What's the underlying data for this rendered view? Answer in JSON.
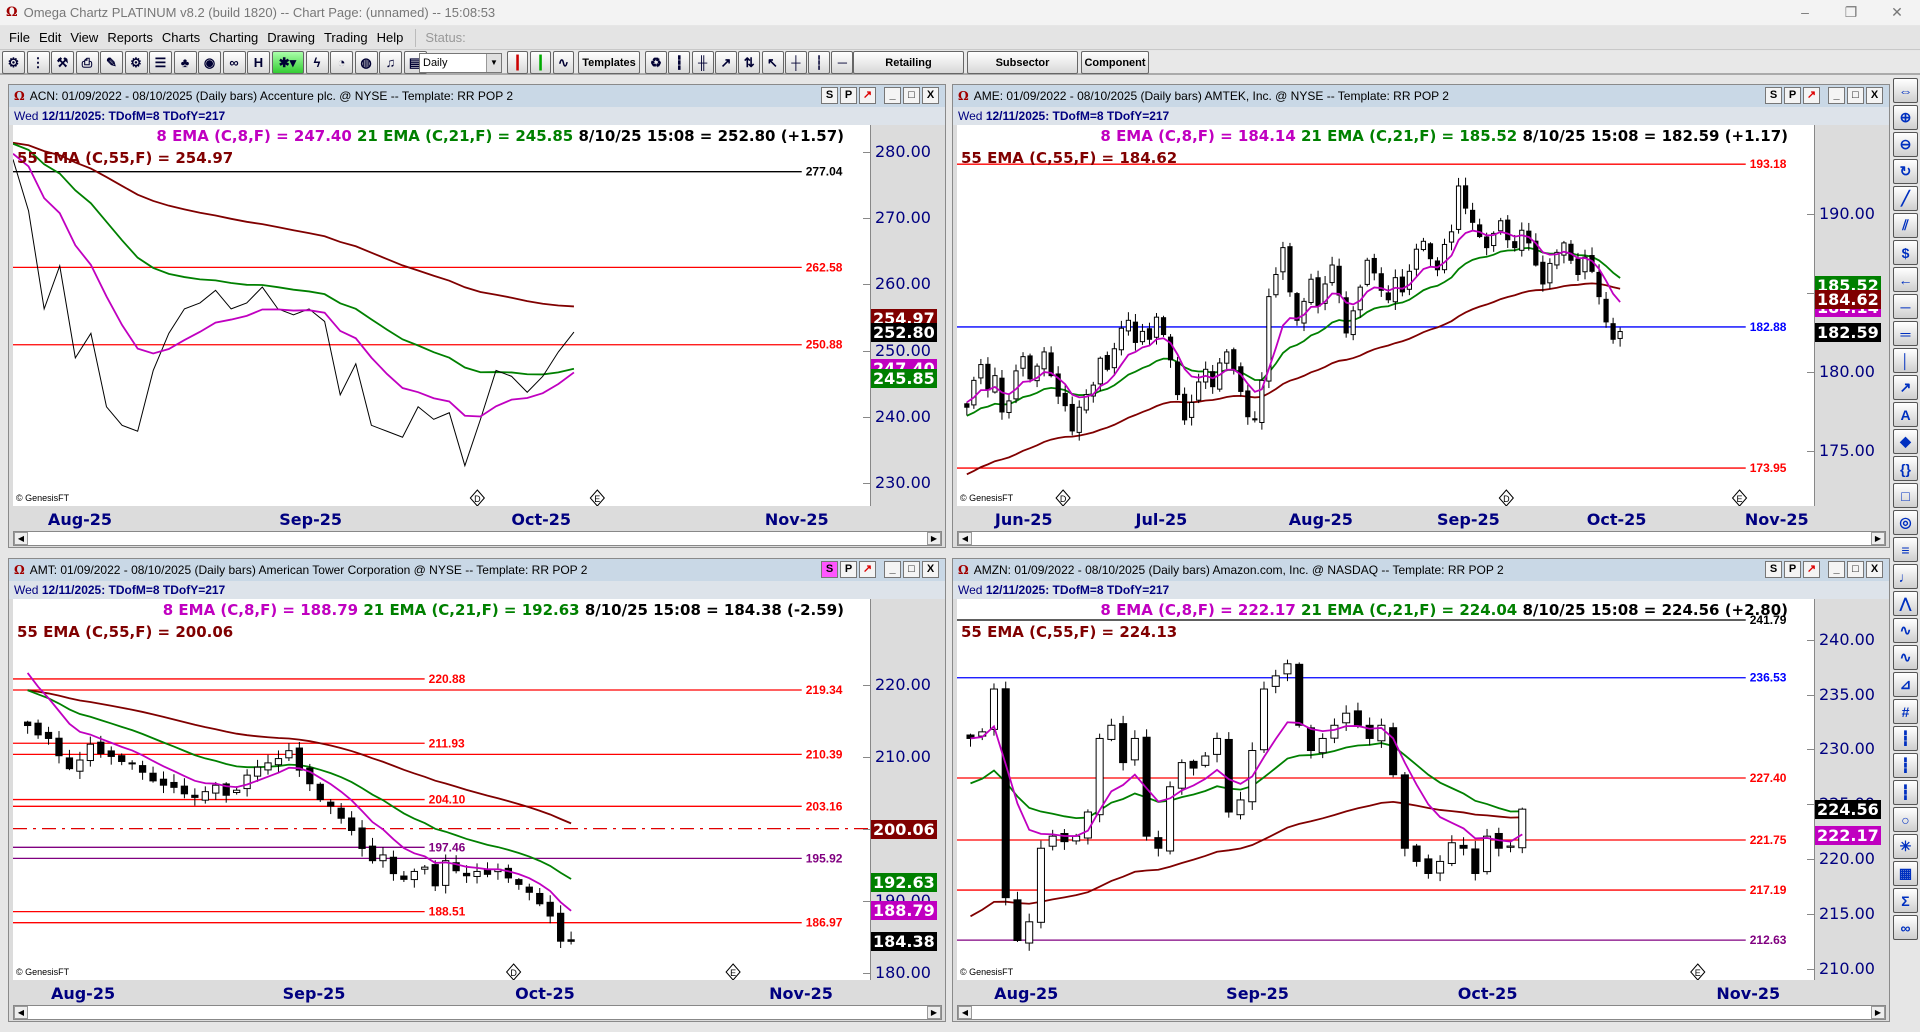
{
  "window": {
    "title": "Omega Chartz PLATINUM v8.2 (build 1820)  --  Chart Page: (unnamed) -- 15:08:53",
    "minimize": "–",
    "restore": "❐",
    "close": "✕"
  },
  "menu": [
    "File",
    "Edit",
    "View",
    "Reports",
    "Charts",
    "Charting",
    "Drawing",
    "Trading",
    "Help"
  ],
  "status_label": "Status:",
  "toolbar": {
    "icons_left": [
      "gear-icon",
      "traffic-light-icon",
      "tools-icon",
      "printer-icon",
      "pen-icon",
      "gears-icon",
      "list-icon",
      "hierarchy-icon",
      "camera-icon",
      "link-icon",
      "ladder-icon"
    ],
    "icons_mid": [
      "lightning-icon",
      "gauge-icon",
      "disk-icon",
      "bell-icon",
      "notes-icon"
    ],
    "period": "Daily",
    "templates": "Templates",
    "retailing": "Retailing",
    "subsector": "Subsector",
    "component": "Component",
    "icons_right": [
      "recycle-icon",
      "bars-icon",
      "bars-red-icon",
      "trend-icon",
      "sort-icon",
      "cursor-icon",
      "crosshair-icon",
      "vline-icon",
      "hline-icon"
    ]
  },
  "right_toolbar": [
    "pan-icon",
    "zoom-in-icon",
    "zoom-out-icon",
    "refresh-icon",
    "trendline-icon",
    "channel-icon",
    "dollar-line-icon",
    "arrow-left-icon",
    "horizontal-line-icon",
    "double-line-icon",
    "vertical-line-icon",
    "arrow-icon",
    "text-icon",
    "shapes-icon",
    "brackets-icon",
    "rectangle-icon",
    "circle-icon",
    "rps-icon",
    "fib-icon",
    "pattern-icon",
    "wave-icon",
    "wave2-icon",
    "fan-icon",
    "grid-icon",
    "bars2-icon",
    "bars3-icon",
    "bars4-icon",
    "cycles-icon",
    "gann-icon",
    "boxes-icon",
    "sigma-icon",
    "chain-icon"
  ],
  "colors": {
    "ema8": "#c000c0",
    "ema21": "#008000",
    "ema55": "#800000",
    "close": "#000000",
    "up": "#ffffff",
    "down": "#000000"
  },
  "panels": [
    {
      "symbol": "ACN",
      "title": "ACN:  01/09/2022 - 08/10/2025  (Daily bars)  Accenture plc. @ NYSE  --  Template: RR POP 2",
      "day": "Wed",
      "date_info": "12/11/2025:  TDofM=8  TDofY=217",
      "ema8_label": "8 EMA (C,8,F) = 247.40",
      "ema21_label": "21 EMA (C,21,F) = 245.85",
      "last_label": "8/10/25 15:08 = 252.80 (+1.57)",
      "ema55_label": "55 EMA (C,55,F) = 254.97",
      "style": "line",
      "y_range": [
        226.5,
        284.1
      ],
      "slots": 55,
      "start": 0,
      "closes": [
        278.9,
        271.1,
        256.3,
        262.8,
        248.9,
        252.6,
        241.5,
        238.7,
        237.8,
        247,
        252.6,
        256.3,
        257.2,
        259.1,
        256.3,
        257.2,
        259.6,
        256.3,
        255.4,
        256.3,
        254.4,
        243.3,
        248,
        238.7,
        237.8,
        236.9,
        241.5,
        239.6,
        240.6,
        232.6,
        239.6,
        247,
        246.1,
        243.7,
        246.1,
        249.8,
        252.8
      ],
      "ema_seed": [
        280,
        281.5,
        281.5
      ],
      "y_ticks": [
        280,
        270,
        260,
        250,
        240,
        230
      ],
      "levels": [
        {
          "value": 277.04,
          "label": "277.04",
          "color": "#000000",
          "pos": "right"
        },
        {
          "value": 262.58,
          "label": "262.58",
          "color": "#ff0000",
          "pos": "right"
        },
        {
          "value": 250.88,
          "label": "250.88",
          "color": "#ff0000",
          "pos": "right"
        }
      ],
      "value_boxes": [
        {
          "text": "254.97",
          "color": "#800000"
        },
        {
          "text": "252.80",
          "color": "#000000"
        },
        {
          "text": "247.40",
          "color": "#c000c0"
        },
        {
          "text": "245.85",
          "color": "#008000"
        }
      ],
      "months": [
        {
          "label": "Aug-25",
          "i": 4.3
        },
        {
          "label": "Sep-25",
          "i": 19.1
        },
        {
          "label": "Oct-25",
          "i": 33.9
        },
        {
          "label": "Nov-25",
          "i": 50.3
        }
      ],
      "events": [
        {
          "label": "D",
          "i": 29.8
        },
        {
          "label": "E",
          "i": 37.5
        }
      ],
      "credit": "© GenesisFT",
      "s_active": false
    },
    {
      "symbol": "AME",
      "title": "AME:  01/09/2022 - 08/10/2025  (Daily bars)  AMTEK, Inc. @ NYSE  --  Template: RR POP 2",
      "day": "Wed",
      "date_info": "12/11/2025:  TDofM=8  TDofY=217",
      "ema8_label": "8 EMA (C,8,F) = 184.14",
      "ema21_label": "21 EMA (C,21,F) = 185.52",
      "last_label": "8/10/25 15:08 = 182.59 (+1.17)",
      "ema55_label": "55 EMA (C,55,F) = 184.62",
      "style": "candle",
      "y_range": [
        171.55,
        195.66
      ],
      "slots": 122,
      "start": 1.4,
      "closes": [
        177.8,
        179.5,
        180.5,
        178.9,
        179.8,
        177.5,
        178.2,
        180.1,
        181,
        179.6,
        180.4,
        181.3,
        179.8,
        178.5,
        177.9,
        176.3,
        177.8,
        178.6,
        179.2,
        180.9,
        180.2,
        181.5,
        182.8,
        183.3,
        181.9,
        182.6,
        182.1,
        183.5,
        182.4,
        180.8,
        178.6,
        177,
        178.1,
        179.4,
        180.2,
        179.1,
        180.6,
        181.3,
        180.2,
        178.8,
        177.2,
        177,
        179.5,
        184.8,
        186.2,
        187.9,
        185.1,
        183.3,
        184.5,
        185.9,
        184.2,
        185.6,
        186.8,
        184.9,
        182.5,
        183.9,
        185.4,
        187.1,
        186.3,
        185.2,
        184.6,
        186,
        185.1,
        186.4,
        187.8,
        188.3,
        187.2,
        186.5,
        188.1,
        188.9,
        191.8,
        190.4,
        189.5,
        188.6,
        187.9,
        188.8,
        189.6,
        188.4,
        187.9,
        189,
        188.2,
        186.8,
        185.6,
        186.9,
        187.6,
        188.2,
        187.1,
        186.2,
        187.3,
        186.4,
        184.8,
        183.2,
        182.1,
        182.59
      ],
      "ema_seed": [
        178.2,
        177.2,
        173.4
      ],
      "y_ticks": [
        190,
        185,
        180,
        175
      ],
      "levels": [
        {
          "value": 193.18,
          "label": "193.18",
          "color": "#ff0000",
          "pos": "right"
        },
        {
          "value": 182.88,
          "label": "182.88",
          "color": "#0000ff",
          "pos": "right"
        },
        {
          "value": 173.95,
          "label": "173.95",
          "color": "#ff0000",
          "pos": "right"
        }
      ],
      "value_boxes": [
        {
          "text": "185.52",
          "color": "#008000"
        },
        {
          "text": "184.14",
          "color": "#c000c0"
        },
        {
          "text": "184.62",
          "color": "#800000"
        },
        {
          "text": "182.59",
          "color": "#000000"
        }
      ],
      "months": [
        {
          "label": "Jun-25",
          "i": 9.5
        },
        {
          "label": "Jul-25",
          "i": 29.1
        },
        {
          "label": "Aug-25",
          "i": 51.8
        },
        {
          "label": "Sep-25",
          "i": 72.8
        },
        {
          "label": "Oct-25",
          "i": 93.9
        },
        {
          "label": "Nov-25",
          "i": 116.7
        }
      ],
      "events": [
        {
          "label": "D",
          "i": 15.1
        },
        {
          "label": "D",
          "i": 78.2
        },
        {
          "label": "E",
          "i": 111.4
        }
      ],
      "credit": "© GenesisFT",
      "s_active": false
    },
    {
      "symbol": "AMT",
      "title": "AMT:  01/09/2022 - 08/10/2025  (Daily bars)  American Tower Corporation @ NYSE  --  Template: RR POP 2",
      "day": "Wed",
      "date_info": "12/11/2025:  TDofM=8  TDofY=217",
      "ema8_label": "8 EMA (C,8,F) = 188.79",
      "ema21_label": "21 EMA (C,21,F) = 192.63",
      "last_label": "8/10/25 15:08 = 184.38 (-2.59)",
      "ema55_label": "55 EMA (C,55,F) = 200.06",
      "style": "candle",
      "y_range": [
        179,
        232
      ],
      "slots": 82,
      "start": 1.4,
      "closes": [
        214.4,
        213.1,
        212.6,
        210.2,
        208.4,
        209.6,
        211.8,
        210.5,
        210.1,
        209.4,
        209.2,
        207.9,
        206.7,
        206.1,
        205.8,
        204.9,
        204.4,
        205.2,
        206.1,
        204.7,
        205.4,
        207.5,
        208.6,
        209.2,
        209.8,
        210.9,
        208.2,
        206.3,
        204.1,
        203.2,
        201.5,
        199.8,
        197.3,
        195.6,
        196.4,
        193.8,
        193,
        194.1,
        194.7,
        192.1,
        195.6,
        194.2,
        193.5,
        194.1,
        193.7,
        194.4,
        193.2,
        192.3,
        191.2,
        189.6,
        187.9,
        184.4,
        184.38
      ],
      "ema_seed": [
        223.8,
        219.8,
        219.5
      ],
      "y_ticks": [
        220,
        210,
        200,
        190,
        180
      ],
      "levels": [
        {
          "value": 220.88,
          "label": "220.88",
          "color": "#ff0000",
          "pos": "mid"
        },
        {
          "value": 219.34,
          "label": "219.34",
          "color": "#ff0000",
          "pos": "right"
        },
        {
          "value": 211.93,
          "label": "211.93",
          "color": "#ff0000",
          "pos": "mid"
        },
        {
          "value": 210.39,
          "label": "210.39",
          "color": "#ff0000",
          "pos": "right"
        },
        {
          "value": 204.1,
          "label": "204.10",
          "color": "#ff0000",
          "pos": "mid"
        },
        {
          "value": 203.16,
          "label": "203.16",
          "color": "#ff0000",
          "pos": "right"
        },
        {
          "value": 200.06,
          "label": "",
          "color": "#e00000",
          "pos": "dash"
        },
        {
          "value": 197.46,
          "label": "197.46",
          "color": "#800080",
          "pos": "mid"
        },
        {
          "value": 195.92,
          "label": "195.92",
          "color": "#800080",
          "pos": "right"
        },
        {
          "value": 188.51,
          "label": "188.51",
          "color": "#ff0000",
          "pos": "mid"
        },
        {
          "value": 186.97,
          "label": "186.97",
          "color": "#ff0000",
          "pos": "right"
        }
      ],
      "value_boxes": [
        {
          "text": "200.06",
          "color": "#800000"
        },
        {
          "text": "192.63",
          "color": "#008000"
        },
        {
          "text": "188.79",
          "color": "#c000c0"
        },
        {
          "text": "184.38",
          "color": "#000000"
        }
      ],
      "months": [
        {
          "label": "Aug-25",
          "i": 6.7
        },
        {
          "label": "Sep-25",
          "i": 28.8
        },
        {
          "label": "Oct-25",
          "i": 50.9
        },
        {
          "label": "Nov-25",
          "i": 75.4
        }
      ],
      "events": [
        {
          "label": "D",
          "i": 47.9
        },
        {
          "label": "E",
          "i": 68.9
        }
      ],
      "credit": "© GenesisFT",
      "s_active": true
    },
    {
      "symbol": "AMZN",
      "title": "AMZN:  01/09/2022 - 08/10/2025  (Daily bars)  Amazon.com, Inc. @ NASDAQ  --  Template: RR POP 2",
      "day": "Wed",
      "date_info": "12/11/2025:  TDofM=8  TDofY=217",
      "ema8_label": "8 EMA (C,8,F) = 222.17",
      "ema21_label": "21 EMA (C,21,F) = 224.04",
      "last_label": "8/10/25 15:08 = 224.56 (+2.80)",
      "ema55_label": "55 EMA (C,55,F) = 224.13",
      "style": "candle",
      "y_range": [
        209,
        243.7
      ],
      "slots": 73,
      "start": 1.15,
      "closes": [
        231,
        231.6,
        235.5,
        216.5,
        212.6,
        214.3,
        221,
        222.1,
        221.6,
        222.1,
        224.3,
        231,
        232.2,
        228.8,
        231,
        222.1,
        221,
        226.6,
        228.8,
        228.3,
        229.4,
        231,
        224.3,
        225.4,
        229.9,
        235.5,
        236.7,
        237.8,
        232.2,
        229.9,
        231,
        232.2,
        233.3,
        232.2,
        231,
        232.2,
        227.7,
        221,
        219.8,
        218.7,
        219.8,
        221.5,
        221,
        218.7,
        222.1,
        221,
        221.2,
        224.56
      ],
      "ema_seed": [
        231,
        226.5,
        214.2
      ],
      "y_ticks": [
        240,
        235,
        230,
        225,
        220,
        215,
        210
      ],
      "levels": [
        {
          "value": 241.79,
          "label": "241.79",
          "color": "#000000",
          "pos": "right"
        },
        {
          "value": 236.53,
          "label": "236.53",
          "color": "#0000ff",
          "pos": "right"
        },
        {
          "value": 227.4,
          "label": "227.40",
          "color": "#ff0000",
          "pos": "right"
        },
        {
          "value": 221.75,
          "label": "221.75",
          "color": "#ff0000",
          "pos": "right"
        },
        {
          "value": 217.19,
          "label": "217.19",
          "color": "#ff0000",
          "pos": "right"
        },
        {
          "value": 212.63,
          "label": "212.63",
          "color": "#800080",
          "pos": "right"
        }
      ],
      "value_boxes": [
        {
          "text": "224.56",
          "color": "#000000"
        },
        {
          "text": "222.17",
          "color": "#c000c0"
        }
      ],
      "months": [
        {
          "label": "Aug-25",
          "i": 5.9
        },
        {
          "label": "Sep-25",
          "i": 25.6
        },
        {
          "label": "Oct-25",
          "i": 45.2
        },
        {
          "label": "Nov-25",
          "i": 67.4
        }
      ],
      "events": [
        {
          "label": "E",
          "i": 63.1
        }
      ],
      "credit": "© GenesisFT",
      "s_active": false
    }
  ]
}
